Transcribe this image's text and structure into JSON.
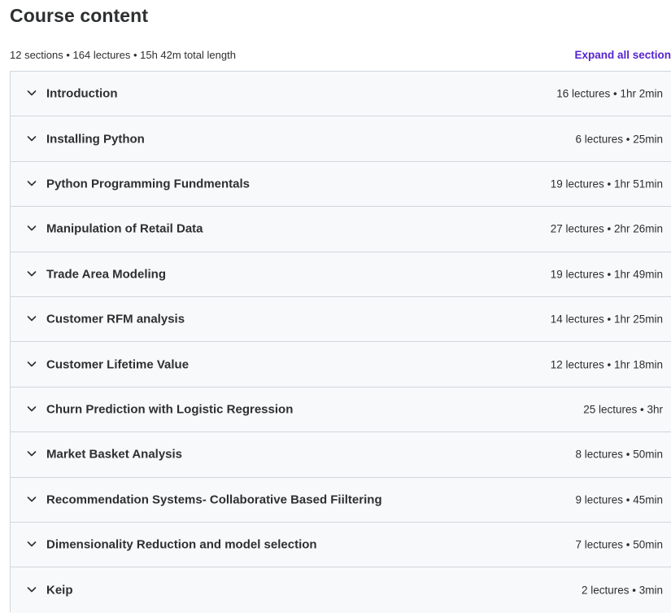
{
  "header": {
    "title": "Course content",
    "summary": "12 sections • 164 lectures • 15h 42m total length",
    "expand_label": "Expand all section"
  },
  "colors": {
    "accent": "#5624d0",
    "text": "#2d2f31",
    "section_bg": "#f7f9fa",
    "border": "#d1d7dc"
  },
  "sections": [
    {
      "title": "Introduction",
      "info": "16 lectures • 1hr 2min",
      "icon": "chevron-down-icon"
    },
    {
      "title": "Installing Python",
      "info": "6 lectures • 25min",
      "icon": "chevron-down-icon"
    },
    {
      "title": "Python Programming Fundmentals",
      "info": "19 lectures • 1hr 51min",
      "icon": "chevron-down-icon"
    },
    {
      "title": "Manipulation of Retail Data",
      "info": "27 lectures • 2hr 26min",
      "icon": "chevron-down-icon"
    },
    {
      "title": "Trade Area Modeling",
      "info": "19 lectures • 1hr 49min",
      "icon": "chevron-down-icon"
    },
    {
      "title": "Customer RFM analysis",
      "info": "14 lectures • 1hr 25min",
      "icon": "chevron-down-icon"
    },
    {
      "title": "Customer Lifetime Value",
      "info": "12 lectures • 1hr 18min",
      "icon": "chevron-down-icon"
    },
    {
      "title": "Churn Prediction with Logistic Regression",
      "info": "25 lectures • 3hr",
      "icon": "chevron-down-icon"
    },
    {
      "title": "Market Basket Analysis",
      "info": "8 lectures • 50min",
      "icon": "chevron-down-icon"
    },
    {
      "title": "Recommendation Systems- Collaborative Based Fiiltering",
      "info": "9 lectures • 45min",
      "icon": "chevron-down-icon"
    },
    {
      "title": "Dimensionality Reduction and model selection",
      "info": "7 lectures • 50min",
      "icon": "chevron-down-icon"
    },
    {
      "title": "Keip",
      "info": "2 lectures • 3min",
      "icon": "chevron-down-icon"
    }
  ]
}
